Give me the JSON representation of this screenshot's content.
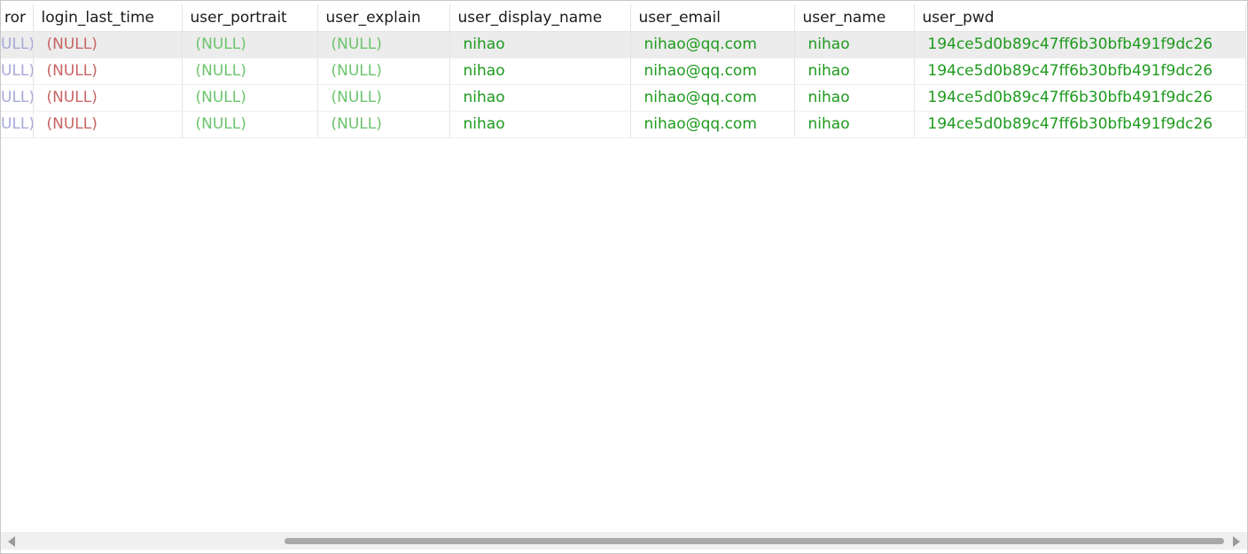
{
  "grid": {
    "columns": [
      "ror",
      "login_last_time",
      "user_portrait",
      "user_explain",
      "user_display_name",
      "user_email",
      "user_name",
      "user_pwd"
    ],
    "rows": [
      [
        "ULL)",
        "(NULL)",
        "(NULL)",
        "(NULL)",
        "nihao",
        "nihao@qq.com",
        "nihao",
        "194ce5d0b89c47ff6b30bfb491f9dc26"
      ],
      [
        "ULL)",
        "(NULL)",
        "(NULL)",
        "(NULL)",
        "nihao",
        "nihao@qq.com",
        "nihao",
        "194ce5d0b89c47ff6b30bfb491f9dc26"
      ],
      [
        "ULL)",
        "(NULL)",
        "(NULL)",
        "(NULL)",
        "nihao",
        "nihao@qq.com",
        "nihao",
        "194ce5d0b89c47ff6b30bfb491f9dc26"
      ],
      [
        "ULL)",
        "(NULL)",
        "(NULL)",
        "(NULL)",
        "nihao",
        "nihao@qq.com",
        "nihao",
        "194ce5d0b89c47ff6b30bfb491f9dc26"
      ]
    ],
    "selected_row": 0
  },
  "colors": {
    "null_truncated": "#a8a8d8",
    "null_red": "#c86464",
    "null_green": "#6cc46c",
    "value_green": "#1e9a1e",
    "selected_row_bg": "#ececec"
  },
  "scrollbar": {
    "left_arrow_icon": "scroll-left-arrow-icon",
    "right_arrow_icon": "scroll-right-arrow-icon"
  }
}
